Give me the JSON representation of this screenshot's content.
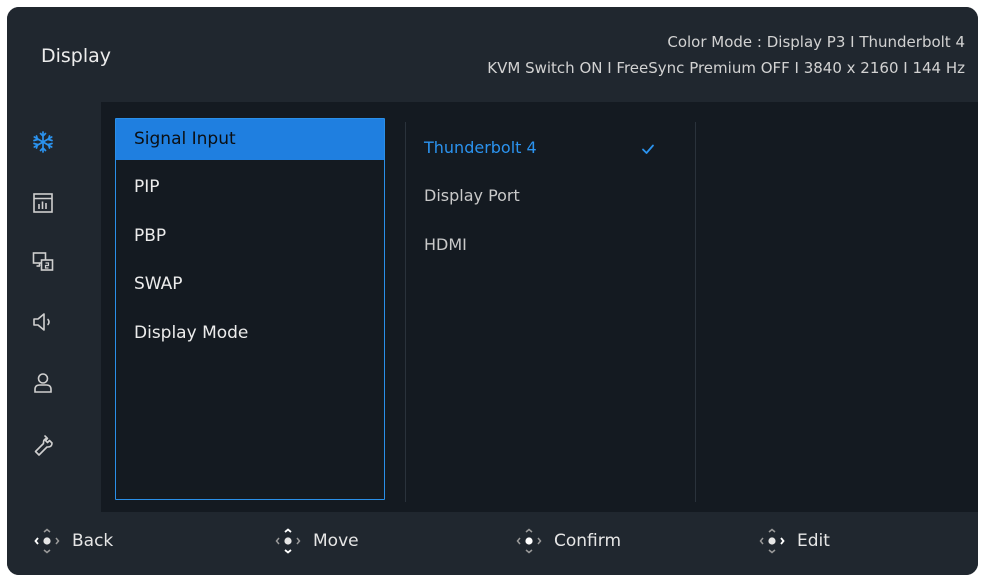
{
  "header": {
    "title": "Display",
    "status_line1": "Color Mode : Display P3  I  Thunderbolt 4",
    "status_line2": "KVM Switch ON  I  FreeSync Premium OFF  I  3840 x 2160  I  144 Hz"
  },
  "sidebar": {
    "icons": [
      "brightness-icon",
      "picture-icon",
      "pip-icon",
      "speaker-icon",
      "user-icon",
      "wrench-icon"
    ],
    "active_icon_color": "#2b93ef"
  },
  "menu": {
    "items": [
      {
        "label": "Signal Input",
        "active": true
      },
      {
        "label": "PIP"
      },
      {
        "label": "PBP"
      },
      {
        "label": "SWAP"
      },
      {
        "label": "Display Mode"
      }
    ]
  },
  "submenu": {
    "options": [
      {
        "label": "Thunderbolt 4",
        "selected": true
      },
      {
        "label": "Display Port"
      },
      {
        "label": "HDMI"
      }
    ]
  },
  "footer": {
    "back": "Back",
    "move": "Move",
    "confirm": "Confirm",
    "edit": "Edit"
  },
  "colors": {
    "accent": "#1f7fe0",
    "background": "#141a21",
    "panel": "#20272f"
  }
}
